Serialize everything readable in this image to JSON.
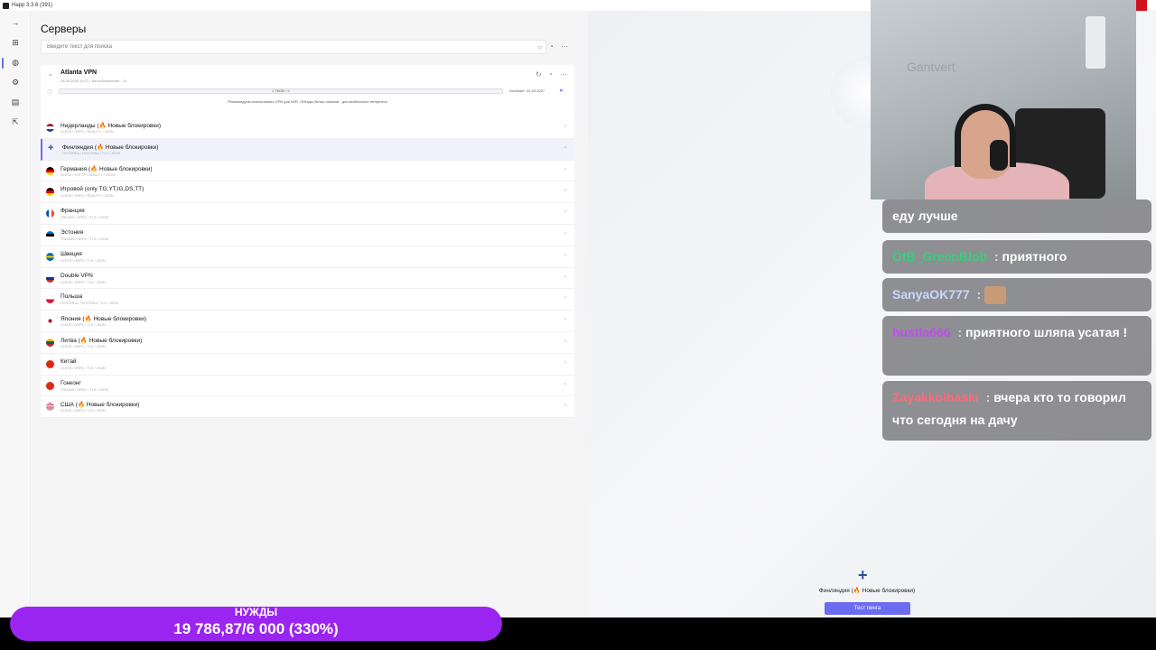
{
  "window": {
    "title": "Happ 3.3.6 (391)"
  },
  "sidebar": {
    "icons": [
      "arrow-right-icon",
      "plus-square-icon",
      "globe-icon",
      "settings-icon",
      "chart-icon",
      "exit-icon"
    ]
  },
  "page": {
    "title": "Серверы",
    "search_placeholder": "Введите текст для поиска"
  },
  "group": {
    "name": "Atlanta VPN",
    "subtitle": "25.06.2025 19:27 | Автообновление · 1ч",
    "traffic": "1.76GB / ∞",
    "expires": "Истекает: 31.03.2027",
    "notice": "Рекомендуем использовать VPN для WiFi, Обходы белых списков - для мобильного интернета"
  },
  "servers": [
    {
      "name": "Нидерланды (🔥 Новые блокировки)",
      "proto": "VLESS / GRPC / REALITY / JSON",
      "flag": "nl"
    },
    {
      "name": "Финляндия (🔥 Новые блокировки)",
      "proto": "HYSTERIA / HYSTERIA / TLS / JSON",
      "flag": "fi"
    },
    {
      "name": "Германия (🔥 Новые блокировки)",
      "proto": "VLESS / XHTTP / REALITY / JSON",
      "flag": "de"
    },
    {
      "name": "Игровой (only TG,YT,IG,DS,TT)",
      "proto": "VLESS / GRPC / REALITY / JSON",
      "flag": "de"
    },
    {
      "name": "Франция",
      "proto": "TROJAN / GRPC / TLS / JSON",
      "flag": "fr"
    },
    {
      "name": "Эстония",
      "proto": "TROJAN / GRPC / TLS / JSON",
      "flag": "ee"
    },
    {
      "name": "Швеция",
      "proto": "VLESS / GRPC / TLS / JSON",
      "flag": "se"
    },
    {
      "name": "Double VPN",
      "proto": "VLESS / GRPC / TLS / JSON",
      "flag": "ru"
    },
    {
      "name": "Польша",
      "proto": "HYSTERIA / HYSTERIA / TLS / JSON",
      "flag": "pl"
    },
    {
      "name": "Япония (🔥 Новые блокировки)",
      "proto": "VLESS / GRPC / TLS / JSON",
      "flag": "jp"
    },
    {
      "name": "Литва (🔥 Новые блокировки)",
      "proto": "VLESS / GRPC / TLS / JSON",
      "flag": "lt"
    },
    {
      "name": "Китай",
      "proto": "VLESS / GRPC / TLS / JSON",
      "flag": "cn"
    },
    {
      "name": "Гонконг",
      "proto": "TROJAN / GRPC / TLS / JSON",
      "flag": "hk"
    },
    {
      "name": "США (🔥 Новые блокировки)",
      "proto": "VLESS / GRPC / TLS / JSON",
      "flag": "us"
    }
  ],
  "selected_index": 1,
  "connection": {
    "current_server": "Финляндия (🔥 Новые блокировки)",
    "ping_button": "Тест пинга"
  },
  "webcam": {
    "wall_text": "Gantvert"
  },
  "chat": [
    {
      "user": "",
      "user_color": "#ffffff",
      "text": "еду лучше"
    },
    {
      "user": "OtB_GreenBlob",
      "user_color": "#35d07a",
      "text": "приятного"
    },
    {
      "user": "SanyaOK777",
      "user_color": "#c9d6ff",
      "text": "",
      "emote": true
    },
    {
      "user": "hustla666",
      "user_color": "#c04cf0",
      "text": "приятного шляпа усатая !"
    },
    {
      "user": "Zayakkolbaski",
      "user_color": "#ff6b78",
      "text": "вчера кто то говорил что сегодня на дачу"
    }
  ],
  "goal": {
    "title": "НУЖДЫ",
    "value": "19 786,87/6 000 (330%)",
    "color": "#9b25f0"
  },
  "flag_colors": {
    "nl": "linear-gradient(#ae1c28 33%, #fff 33% 66%, #21468b 66%)",
    "fi": "plus",
    "de": "linear-gradient(#000 33%, #dd0000 33% 66%, #ffce00 66%)",
    "fr": "linear-gradient(90deg, #0055a4 33%, #fff 33% 66%, #ef4135 66%)",
    "ee": "linear-gradient(#0072ce 33%, #000 33% 66%, #fff 66%)",
    "se": "linear-gradient(#006aa7 40%, #fecc00 40% 60%, #006aa7 60%)",
    "ru": "linear-gradient(#fff 33%, #0039a6 33% 66%, #d52b1e 66%)",
    "pl": "linear-gradient(#fff 50%, #dc143c 50%)",
    "jp": "radial-gradient(circle, #bc002d 30%, #fff 32%)",
    "lt": "linear-gradient(#fdb913 33%, #006a44 33% 66%, #c1272d 66%)",
    "cn": "#de2910",
    "hk": "#de2910",
    "us": "repeating-linear-gradient(#b22234 0 12%, #fff 12% 24%)"
  }
}
